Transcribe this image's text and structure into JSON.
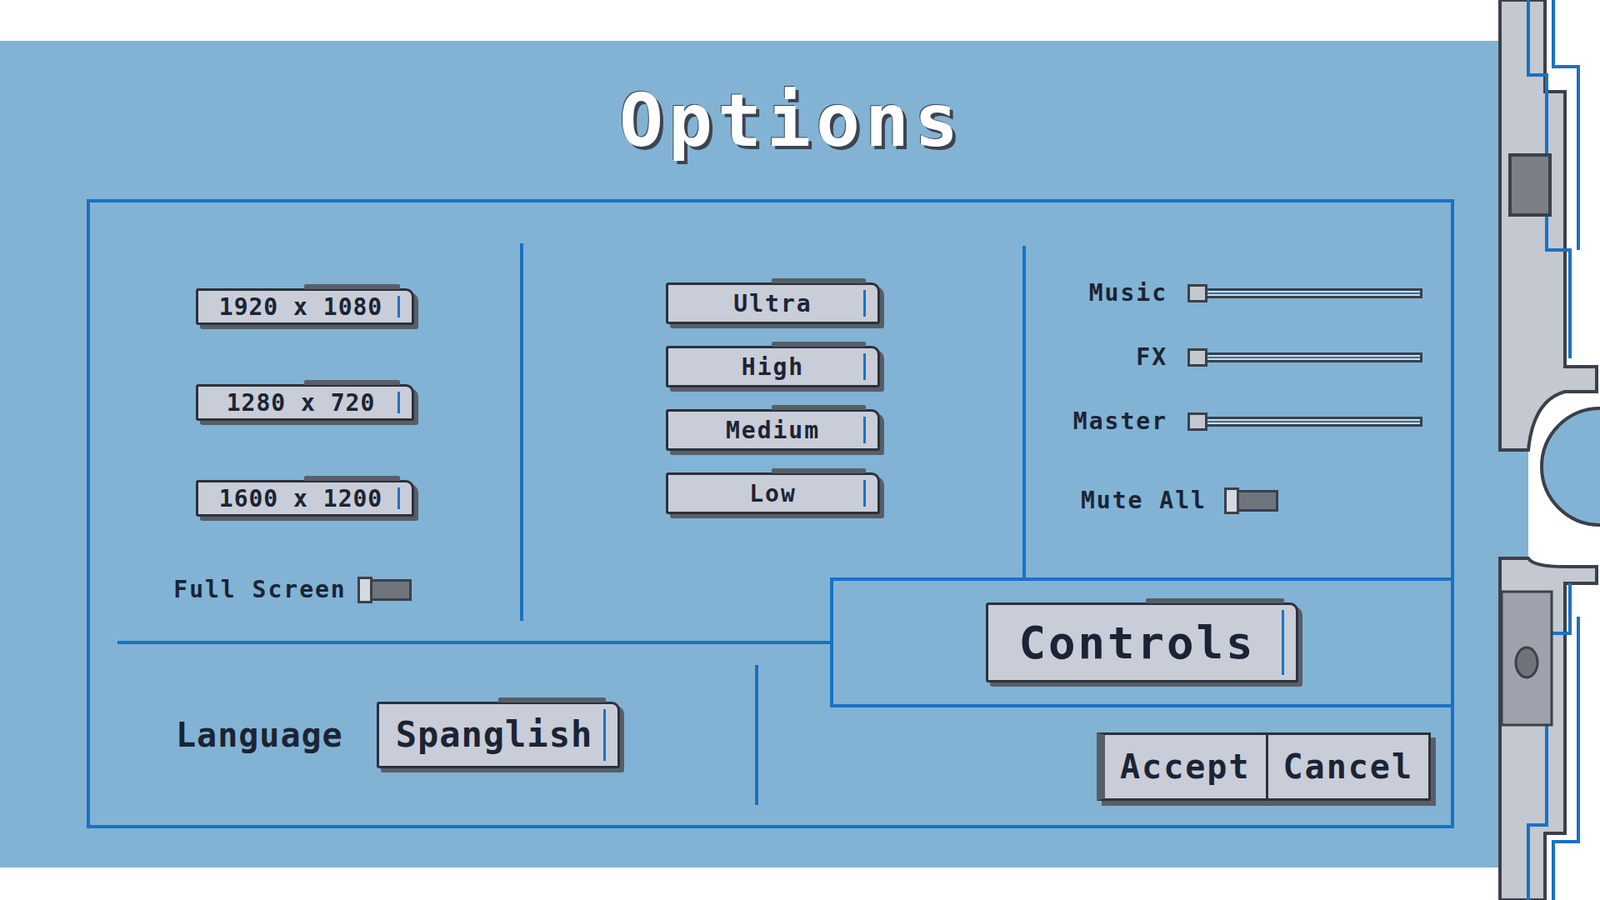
{
  "title": "Options",
  "display": {
    "resolutions": [
      {
        "label": "1920 x 1080",
        "selected": false
      },
      {
        "label": "1280 x 720",
        "selected": false
      },
      {
        "label": "1600 x 1200",
        "selected": false
      }
    ],
    "fullscreen": {
      "label": "Full Screen",
      "on": false
    }
  },
  "quality": [
    {
      "label": "Ultra",
      "selected": false
    },
    {
      "label": "High",
      "selected": false
    },
    {
      "label": "Medium",
      "selected": false
    },
    {
      "label": "Low",
      "selected": false
    }
  ],
  "audio": {
    "sliders": [
      {
        "label": "Music",
        "level": 0
      },
      {
        "label": "FX",
        "level": 0
      },
      {
        "label": "Master",
        "level": 0
      }
    ],
    "mute": {
      "label": "Mute All",
      "on": false
    }
  },
  "language": {
    "label": "Language",
    "value": "Spanglish"
  },
  "controls": {
    "label": "Controls"
  },
  "buttons": [
    "Accept",
    "Cancel"
  ]
}
